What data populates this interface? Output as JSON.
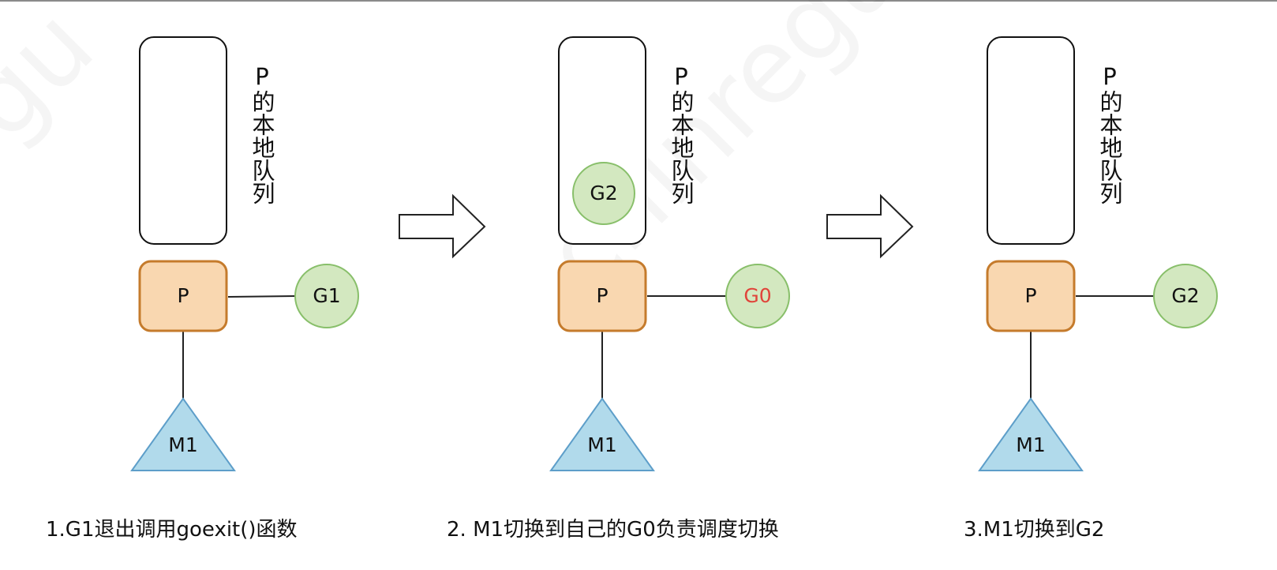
{
  "panels": [
    {
      "queue_label": "P的本地队列",
      "p_label": "P",
      "m_label": "M1",
      "g_label": "G1",
      "queued_g": "",
      "caption": "1.G1退出调用goexit()函数"
    },
    {
      "queue_label": "P的本地队列",
      "p_label": "P",
      "m_label": "M1",
      "g_label": "G0",
      "queued_g": "G2",
      "caption": "2. M1切换到自己的G0负责调度切换"
    },
    {
      "queue_label": "P的本地队列",
      "p_label": "P",
      "m_label": "M1",
      "g_label": "G2",
      "queued_g": "",
      "caption": "3.M1切换到G2"
    }
  ],
  "colors": {
    "p_fill": "#f9d7b0",
    "p_stroke": "#c57b2c",
    "g_fill": "#d3e8c0",
    "g_stroke": "#88bf6a",
    "m_fill": "#b1daeb",
    "m_stroke": "#5d9ec9",
    "g0_text": "#e0443a"
  }
}
